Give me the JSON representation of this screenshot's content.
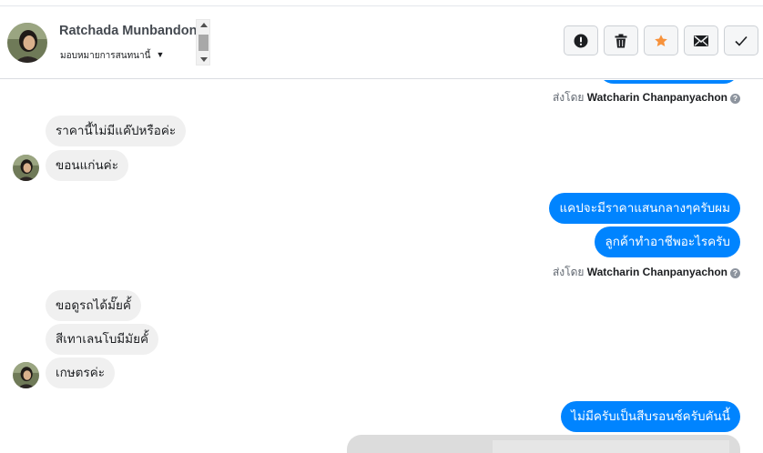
{
  "header": {
    "contact_name": "Ratchada Munbandong",
    "assign_label": "มอบหมายการสนทนานี้",
    "actions": [
      {
        "name": "mark-spam-button",
        "icon": "exclamation-icon"
      },
      {
        "name": "delete-button",
        "icon": "trash-icon"
      },
      {
        "name": "star-button",
        "icon": "star-icon"
      },
      {
        "name": "mark-unread-button",
        "icon": "envelope-icon"
      },
      {
        "name": "mark-done-button",
        "icon": "check-icon"
      }
    ]
  },
  "colors": {
    "outgoing_bubble": "#0084ff",
    "incoming_bubble": "#f0f0f0",
    "star": "#f7923b"
  },
  "messages": {
    "in_1": "ราคานี้ไม่มีแค๊ปหรือค่ะ",
    "in_2": "ขอนแก่นค่ะ",
    "out_1": "แคปจะมีราคาแสนกลางๆครับผม",
    "out_2": "ลูกค้าทำอาชีพอะไรครับ",
    "in_3": "ขอดูรถได้มั๊ยคั้",
    "in_4": "สีเทาเลนโบมีมัยคั้",
    "in_5": "เกษตรค่ะ",
    "out_3": "ไม่มีครับเป็นสีบรอนซ์ครับคันนี้"
  },
  "sent_by": {
    "prefix": "ส่งโดย",
    "agent": "Watcharin Chanpanyachon",
    "help": "?"
  }
}
